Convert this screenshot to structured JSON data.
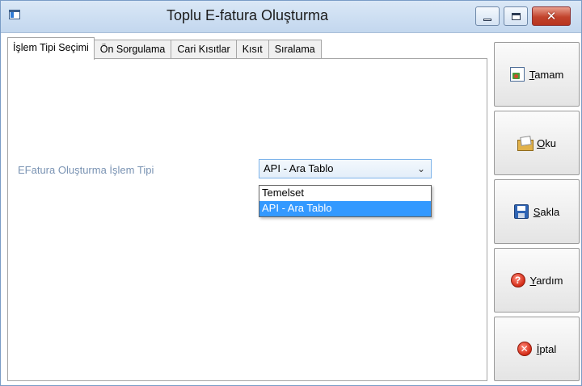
{
  "window": {
    "title": "Toplu E-fatura Oluşturma",
    "close_glyph": "✕"
  },
  "tabs": [
    {
      "label": "İşlem Tipi Seçimi",
      "active": true
    },
    {
      "label": "Ön Sorgulama",
      "active": false
    },
    {
      "label": "Cari Kısıtlar",
      "active": false
    },
    {
      "label": "Kısıt",
      "active": false
    },
    {
      "label": "Sıralama",
      "active": false
    }
  ],
  "form": {
    "field_label": "EFatura Oluşturma İşlem Tipi",
    "combo_value": "API - Ara Tablo",
    "combo_arrow": "⌄",
    "options": [
      {
        "label": "Temelset",
        "selected": false
      },
      {
        "label": "API - Ara Tablo",
        "selected": true
      }
    ]
  },
  "actions": {
    "tamam": {
      "accel": "T",
      "rest": "amam",
      "icon": "document-icon"
    },
    "oku": {
      "accel": "O",
      "rest": "ku",
      "icon": "open-folder-icon"
    },
    "sakla": {
      "accel": "S",
      "rest": "akla",
      "icon": "save-disk-icon"
    },
    "yardim": {
      "accel": "Y",
      "rest": "ardım",
      "icon": "help-icon"
    },
    "iptal": {
      "accel": "İ",
      "rest": "ptal",
      "icon": "cancel-icon",
      "icon_glyph": "✕"
    }
  },
  "colors": {
    "titlebar": "#cfe0f3",
    "field_label": "#7a93b3",
    "selection": "#3399ff",
    "close_button": "#c2432c"
  }
}
